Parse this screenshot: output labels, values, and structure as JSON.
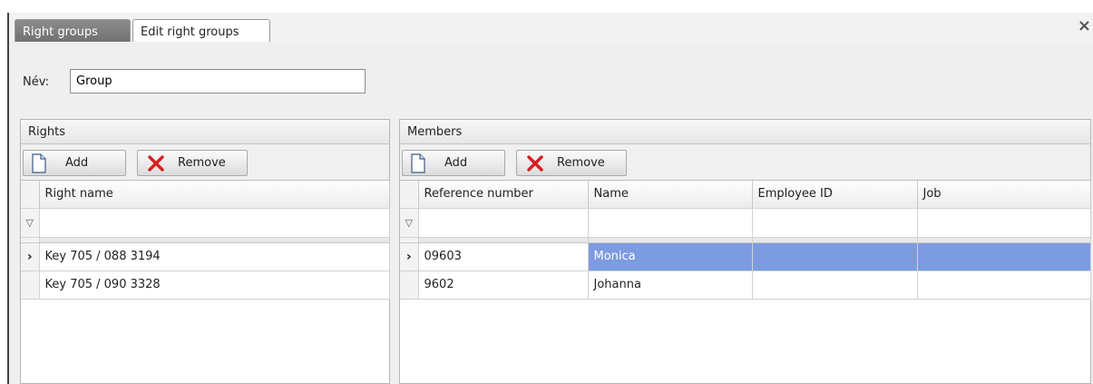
{
  "tabs": [
    {
      "label": "Right groups",
      "active": false
    },
    {
      "label": "Edit right groups",
      "active": true
    }
  ],
  "close_glyph": "×",
  "name_field": {
    "label": "Név:",
    "value": "Group"
  },
  "rights_panel": {
    "title": "Rights",
    "add_label": "Add",
    "remove_label": "Remove",
    "columns": [
      "Right name"
    ],
    "rows": [
      {
        "indicator": "›",
        "cells": [
          "Key 705 / 088 3194"
        ]
      },
      {
        "indicator": "",
        "cells": [
          "Key 705 / 090 3328"
        ]
      }
    ]
  },
  "members_panel": {
    "title": "Members",
    "add_label": "Add",
    "remove_label": "Remove",
    "columns": [
      "Reference number",
      "Name",
      "Employee ID",
      "Job"
    ],
    "rows": [
      {
        "indicator": "›",
        "cells": [
          "09603",
          "Monica",
          "",
          ""
        ],
        "selected": true
      },
      {
        "indicator": "",
        "cells": [
          "9602",
          "Johanna",
          "",
          ""
        ],
        "selected": false
      }
    ]
  },
  "colors": {
    "selection": "#7d9be0",
    "inactive_tab": "#7a7a7a",
    "remove_icon": "#d42020"
  },
  "icons": {
    "add": "new-document-icon",
    "remove": "red-x-icon",
    "filter": "filter-icon",
    "row_pointer": "row-pointer-icon",
    "close": "close-icon"
  }
}
